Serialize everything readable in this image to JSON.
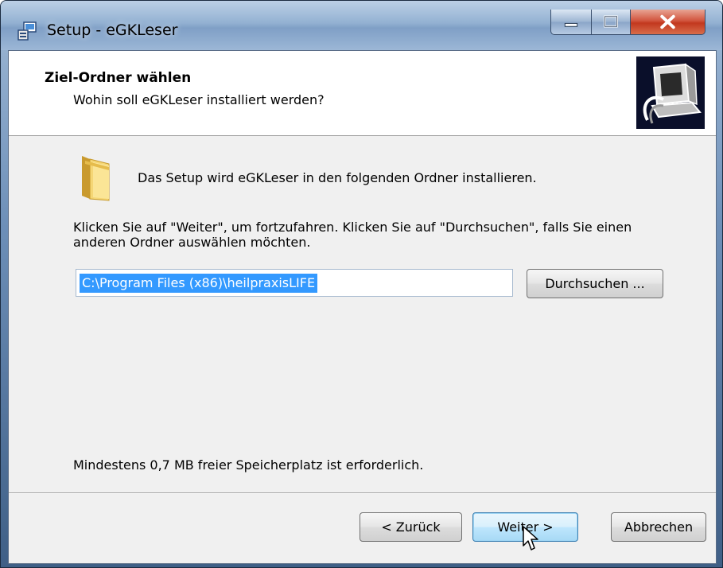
{
  "window": {
    "title": "Setup - eGKLeser",
    "colors": {
      "titlebar": "#93b1d2",
      "close_button": "#c2381f",
      "selection": "#3399ff"
    }
  },
  "header": {
    "title": "Ziel-Ordner wählen",
    "subtitle": "Wohin soll eGKLeser installiert werden?",
    "logo_icon": "computer-install-icon"
  },
  "body": {
    "folder_icon": "folder-icon",
    "intro": "Das Setup wird eGKLeser in den folgenden Ordner installieren.",
    "instruction": "Klicken Sie auf \"Weiter\", um fortzufahren. Klicken Sie auf \"Durchsuchen\", falls Sie einen anderen Ordner auswählen möchten.",
    "path_value": "C:\\Program Files (x86)\\heilpraxisLIFE",
    "browse_label": "Durchsuchen ...",
    "space_required": "Mindestens 0,7 MB freier Speicherplatz ist erforderlich."
  },
  "footer": {
    "back_label": "< Zurück",
    "next_label": "Weiter >",
    "cancel_label": "Abbrechen"
  }
}
